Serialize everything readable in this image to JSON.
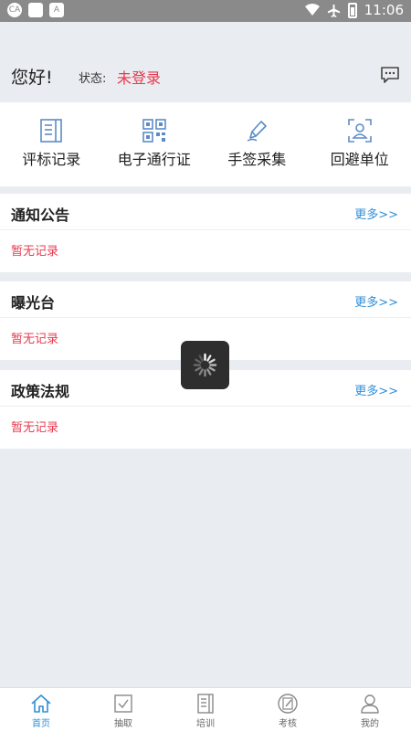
{
  "status_bar": {
    "time": "11:06"
  },
  "header": {
    "greeting": "您好!",
    "status_label": "状态:",
    "status_value": "未登录"
  },
  "quick_actions": [
    {
      "label": "评标记录",
      "icon": "document-list-icon"
    },
    {
      "label": "电子通行证",
      "icon": "qr-code-icon"
    },
    {
      "label": "手签采集",
      "icon": "pen-icon"
    },
    {
      "label": "回避单位",
      "icon": "person-scan-icon"
    }
  ],
  "sections": [
    {
      "title": "通知公告",
      "more": "更多>>",
      "empty": "暂无记录"
    },
    {
      "title": "曝光台",
      "more": "更多>>",
      "empty": "暂无记录"
    },
    {
      "title": "政策法规",
      "more": "更多>>",
      "empty": "暂无记录"
    }
  ],
  "tabs": [
    {
      "label": "首页",
      "icon": "home-icon",
      "active": true
    },
    {
      "label": "抽取",
      "icon": "checkbox-icon",
      "active": false
    },
    {
      "label": "培训",
      "icon": "book-icon",
      "active": false
    },
    {
      "label": "考核",
      "icon": "exam-icon",
      "active": false
    },
    {
      "label": "我的",
      "icon": "user-icon",
      "active": false
    }
  ],
  "colors": {
    "accent": "#2f8fd8",
    "alert": "#e8394d",
    "icon_blue": "#5b8cc7"
  }
}
